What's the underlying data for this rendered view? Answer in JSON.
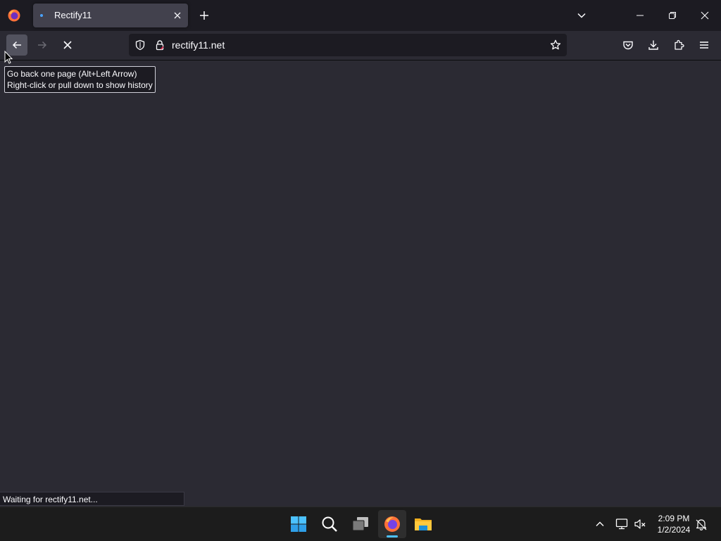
{
  "tab": {
    "title": "Rectify11"
  },
  "urlbar": {
    "url": "rectify11.net"
  },
  "tooltip": {
    "line1": "Go back one page (Alt+Left Arrow)",
    "line2": "Right-click or pull down to show history"
  },
  "status": {
    "text": "Waiting for rectify11.net..."
  },
  "clock": {
    "time": "2:09 PM",
    "date": "1/2/2024"
  },
  "colors": {
    "accent": "#4cc2ff",
    "tab_loading": "#4aa3ff",
    "background": "#2b2a33",
    "toolbar_dark": "#1c1b22"
  },
  "icons": {
    "firefox": "firefox-icon",
    "back": "back-arrow-icon",
    "forward": "forward-arrow-icon",
    "stop": "stop-icon",
    "shield": "shield-icon",
    "lock": "lock-icon",
    "star": "star-icon",
    "pocket": "pocket-icon",
    "downloads": "download-icon",
    "extensions": "puzzle-icon",
    "menu": "hamburger-icon",
    "start": "windows-start-icon",
    "search": "search-icon",
    "taskview": "task-view-icon",
    "explorer": "folder-icon"
  }
}
